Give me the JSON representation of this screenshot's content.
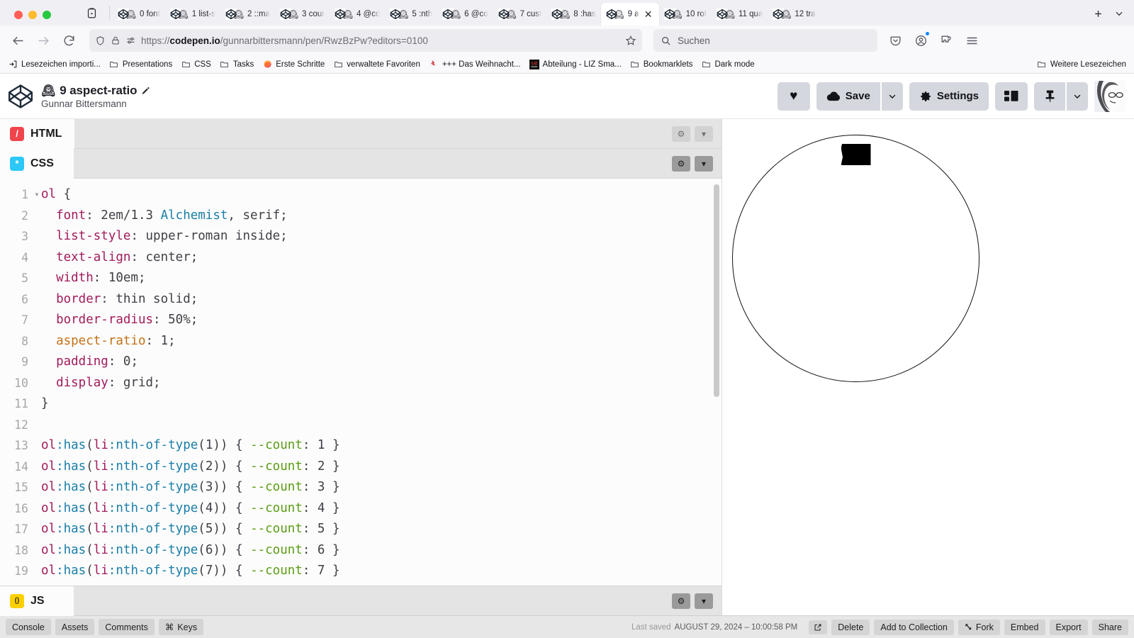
{
  "browser": {
    "window_controls": [
      "close",
      "minimize",
      "maximize"
    ],
    "tab_list_icon": "tab-list-icon",
    "tabs": [
      {
        "title": "0 font",
        "favicon": "codepen-icon",
        "overlay": "clock-emoji",
        "active": false
      },
      {
        "title": "1 list-s",
        "favicon": "codepen-icon",
        "overlay": "clock-emoji",
        "active": false
      },
      {
        "title": "2 ::ma",
        "favicon": "codepen-icon",
        "overlay": "clock-emoji",
        "active": false
      },
      {
        "title": "3 cour",
        "favicon": "codepen-icon",
        "overlay": "clock-emoji",
        "active": false
      },
      {
        "title": "4 @co",
        "favicon": "codepen-icon",
        "overlay": "clock-emoji",
        "active": false
      },
      {
        "title": "5 :nth",
        "favicon": "codepen-icon",
        "overlay": "clock-emoji",
        "active": false
      },
      {
        "title": "6 @co",
        "favicon": "codepen-icon",
        "overlay": "clock-emoji",
        "active": false
      },
      {
        "title": "7 cust",
        "favicon": "codepen-icon",
        "overlay": "clock-emoji",
        "active": false
      },
      {
        "title": "8 :has",
        "favicon": "codepen-icon",
        "overlay": "clock-emoji",
        "active": false
      },
      {
        "title": "9 a",
        "favicon": "codepen-icon",
        "overlay": "clock-emoji",
        "active": true
      },
      {
        "title": "10 rot",
        "favicon": "codepen-icon",
        "overlay": "clock-emoji",
        "active": false
      },
      {
        "title": "11 qua",
        "favicon": "codepen-icon",
        "overlay": "clock-emoji",
        "active": false
      },
      {
        "title": "12 tra",
        "favicon": "codepen-icon",
        "overlay": "clock-emoji",
        "active": false
      }
    ],
    "new_tab_label": "+",
    "list_all_tabs_label": "⌄",
    "nav": {
      "back": "back-arrow",
      "forward": "forward-arrow",
      "reload": "reload-icon",
      "url": "https://codepen.io/gunnarbittersmann/pen/RwzBzPw?editors=0100",
      "url_domain": "codepen.io",
      "url_prefix": "https://",
      "url_suffix": "/gunnarbittersmann/pen/RwzBzPw?editors=0100",
      "bookmark_star": "star-icon",
      "search_placeholder": "Suchen"
    },
    "bookmarks": [
      {
        "label": "Lesezeichen importi...",
        "icon": "import-icon"
      },
      {
        "label": "Presentations",
        "icon": "folder-icon"
      },
      {
        "label": "CSS",
        "icon": "folder-icon"
      },
      {
        "label": "Tasks",
        "icon": "folder-icon"
      },
      {
        "label": "Erste Schritte",
        "icon": "firefox-icon"
      },
      {
        "label": "verwaltete Favoriten",
        "icon": "folder-icon"
      },
      {
        "label": "+++ Das Weihnacht...",
        "icon": "bookmark-pin-icon"
      },
      {
        "label": "Abteilung - LIZ Sma...",
        "icon": "liz-icon"
      },
      {
        "label": "Bookmarklets",
        "icon": "folder-icon"
      },
      {
        "label": "Dark mode",
        "icon": "folder-icon"
      }
    ],
    "bookmarks_overflow": {
      "label": "Weitere Lesezeichen",
      "icon": "folder-icon"
    }
  },
  "pen": {
    "logo": "codepen-logo",
    "title_emoji": "🕰",
    "title": "9 aspect-ratio",
    "edit_icon": "pencil-icon",
    "author": "Gunnar Bittersmann",
    "actions": {
      "love_label": "♥",
      "save_label": "Save",
      "save_caret": "⌄",
      "settings_label": "Settings",
      "layout_label": "layout-icon",
      "pin_label": "pin-icon",
      "pin_caret": "⌄",
      "avatar": "user-avatar"
    }
  },
  "editors": [
    {
      "lang": "HTML",
      "badge": "/",
      "badge_color": "#f0444c",
      "open": false
    },
    {
      "lang": "CSS",
      "badge": "*",
      "badge_color": "#2cc8f7",
      "open": true
    },
    {
      "lang": "JS",
      "badge": "()",
      "badge_color": "#fcd000",
      "open": false
    }
  ],
  "pane_actions": {
    "settings_icon": "gear-icon",
    "collapse_icon": "chevron-down-icon"
  },
  "code": {
    "language": "CSS",
    "lines": [
      {
        "n": "1",
        "fold": "▾",
        "tokens": [
          {
            "t": "ol",
            "c": "t-tag"
          },
          {
            "t": " {",
            "c": "t-punc"
          }
        ]
      },
      {
        "n": "2",
        "fold": "",
        "tokens": [
          {
            "t": "  ",
            "c": "t-punc"
          },
          {
            "t": "font",
            "c": "t-prop"
          },
          {
            "t": ": 2em/1.3 ",
            "c": "t-val"
          },
          {
            "t": "Alchemist",
            "c": "t-font"
          },
          {
            "t": ", serif;",
            "c": "t-val"
          }
        ]
      },
      {
        "n": "3",
        "fold": "",
        "tokens": [
          {
            "t": "  ",
            "c": "t-punc"
          },
          {
            "t": "list-style",
            "c": "t-prop"
          },
          {
            "t": ": upper-roman inside;",
            "c": "t-val"
          }
        ]
      },
      {
        "n": "4",
        "fold": "",
        "tokens": [
          {
            "t": "  ",
            "c": "t-punc"
          },
          {
            "t": "text-align",
            "c": "t-prop"
          },
          {
            "t": ": center;",
            "c": "t-val"
          }
        ]
      },
      {
        "n": "5",
        "fold": "",
        "tokens": [
          {
            "t": "  ",
            "c": "t-punc"
          },
          {
            "t": "width",
            "c": "t-prop"
          },
          {
            "t": ": 10em;",
            "c": "t-val"
          }
        ]
      },
      {
        "n": "6",
        "fold": "",
        "tokens": [
          {
            "t": "  ",
            "c": "t-punc"
          },
          {
            "t": "border",
            "c": "t-prop"
          },
          {
            "t": ": thin solid;",
            "c": "t-val"
          }
        ]
      },
      {
        "n": "7",
        "fold": "",
        "tokens": [
          {
            "t": "  ",
            "c": "t-punc"
          },
          {
            "t": "border-radius",
            "c": "t-prop"
          },
          {
            "t": ": 50%;",
            "c": "t-val"
          }
        ]
      },
      {
        "n": "8",
        "fold": "",
        "tokens": [
          {
            "t": "  ",
            "c": "t-punc"
          },
          {
            "t": "aspect-ratio",
            "c": "t-prop2"
          },
          {
            "t": ": 1;",
            "c": "t-val"
          }
        ]
      },
      {
        "n": "9",
        "fold": "",
        "tokens": [
          {
            "t": "  ",
            "c": "t-punc"
          },
          {
            "t": "padding",
            "c": "t-prop"
          },
          {
            "t": ": 0;",
            "c": "t-val"
          }
        ]
      },
      {
        "n": "10",
        "fold": "",
        "tokens": [
          {
            "t": "  ",
            "c": "t-punc"
          },
          {
            "t": "display",
            "c": "t-prop"
          },
          {
            "t": ": grid;",
            "c": "t-val"
          }
        ]
      },
      {
        "n": "11",
        "fold": "",
        "tokens": [
          {
            "t": "}",
            "c": "t-punc"
          }
        ]
      },
      {
        "n": "12",
        "fold": "",
        "tokens": []
      },
      {
        "n": "13",
        "fold": "",
        "tokens": [
          {
            "t": "ol",
            "c": "t-tag"
          },
          {
            "t": ":has",
            "c": "t-pseudo"
          },
          {
            "t": "(",
            "c": "t-punc"
          },
          {
            "t": "li",
            "c": "t-tag"
          },
          {
            "t": ":nth-of-type",
            "c": "t-pseudo"
          },
          {
            "t": "(1)) { ",
            "c": "t-punc"
          },
          {
            "t": "--count",
            "c": "t-var"
          },
          {
            "t": ": 1 }",
            "c": "t-punc"
          }
        ]
      },
      {
        "n": "14",
        "fold": "",
        "tokens": [
          {
            "t": "ol",
            "c": "t-tag"
          },
          {
            "t": ":has",
            "c": "t-pseudo"
          },
          {
            "t": "(",
            "c": "t-punc"
          },
          {
            "t": "li",
            "c": "t-tag"
          },
          {
            "t": ":nth-of-type",
            "c": "t-pseudo"
          },
          {
            "t": "(2)) { ",
            "c": "t-punc"
          },
          {
            "t": "--count",
            "c": "t-var"
          },
          {
            "t": ": 2 }",
            "c": "t-punc"
          }
        ]
      },
      {
        "n": "15",
        "fold": "",
        "tokens": [
          {
            "t": "ol",
            "c": "t-tag"
          },
          {
            "t": ":has",
            "c": "t-pseudo"
          },
          {
            "t": "(",
            "c": "t-punc"
          },
          {
            "t": "li",
            "c": "t-tag"
          },
          {
            "t": ":nth-of-type",
            "c": "t-pseudo"
          },
          {
            "t": "(3)) { ",
            "c": "t-punc"
          },
          {
            "t": "--count",
            "c": "t-var"
          },
          {
            "t": ": 3 }",
            "c": "t-punc"
          }
        ]
      },
      {
        "n": "16",
        "fold": "",
        "tokens": [
          {
            "t": "ol",
            "c": "t-tag"
          },
          {
            "t": ":has",
            "c": "t-pseudo"
          },
          {
            "t": "(",
            "c": "t-punc"
          },
          {
            "t": "li",
            "c": "t-tag"
          },
          {
            "t": ":nth-of-type",
            "c": "t-pseudo"
          },
          {
            "t": "(4)) { ",
            "c": "t-punc"
          },
          {
            "t": "--count",
            "c": "t-var"
          },
          {
            "t": ": 4 }",
            "c": "t-punc"
          }
        ]
      },
      {
        "n": "17",
        "fold": "",
        "tokens": [
          {
            "t": "ol",
            "c": "t-tag"
          },
          {
            "t": ":has",
            "c": "t-pseudo"
          },
          {
            "t": "(",
            "c": "t-punc"
          },
          {
            "t": "li",
            "c": "t-tag"
          },
          {
            "t": ":nth-of-type",
            "c": "t-pseudo"
          },
          {
            "t": "(5)) { ",
            "c": "t-punc"
          },
          {
            "t": "--count",
            "c": "t-var"
          },
          {
            "t": ": 5 }",
            "c": "t-punc"
          }
        ]
      },
      {
        "n": "18",
        "fold": "",
        "tokens": [
          {
            "t": "ol",
            "c": "t-tag"
          },
          {
            "t": ":has",
            "c": "t-pseudo"
          },
          {
            "t": "(",
            "c": "t-punc"
          },
          {
            "t": "li",
            "c": "t-tag"
          },
          {
            "t": ":nth-of-type",
            "c": "t-pseudo"
          },
          {
            "t": "(6)) { ",
            "c": "t-punc"
          },
          {
            "t": "--count",
            "c": "t-var"
          },
          {
            "t": ": 6 }",
            "c": "t-punc"
          }
        ]
      },
      {
        "n": "19",
        "fold": "",
        "tokens": [
          {
            "t": "ol",
            "c": "t-tag"
          },
          {
            "t": ":has",
            "c": "t-pseudo"
          },
          {
            "t": "(",
            "c": "t-punc"
          },
          {
            "t": "li",
            "c": "t-tag"
          },
          {
            "t": ":nth-of-type",
            "c": "t-pseudo"
          },
          {
            "t": "(7)) { ",
            "c": "t-punc"
          },
          {
            "t": "--count",
            "c": "t-var"
          },
          {
            "t": ": 7 }",
            "c": "t-punc"
          }
        ]
      }
    ]
  },
  "preview": {
    "description": "circular ordered list rendered as a thin black circle with a single black roman numeral glyph at the top",
    "glyph": "I"
  },
  "bottombar": {
    "left_buttons": [
      {
        "label": "Console",
        "icon": ""
      },
      {
        "label": "Assets",
        "icon": ""
      },
      {
        "label": "Comments",
        "icon": ""
      },
      {
        "label": "Keys",
        "icon": "⌘"
      }
    ],
    "saved_label": "Last saved",
    "saved_value": "AUGUST 29, 2024 – 10:00:58 PM",
    "right_buttons": [
      {
        "label": "",
        "icon": "external-link-icon"
      },
      {
        "label": "Delete",
        "icon": ""
      },
      {
        "label": "Add to Collection",
        "icon": ""
      },
      {
        "label": "Fork",
        "icon": "fork-icon"
      },
      {
        "label": "Embed",
        "icon": ""
      },
      {
        "label": "Export",
        "icon": ""
      },
      {
        "label": "Share",
        "icon": ""
      }
    ]
  },
  "colors": {
    "accent_red": "#f0444c",
    "accent_blue": "#2cc8f7",
    "accent_yellow": "#fcd000",
    "chrome_bg": "#f9f9fb",
    "editor_bg": "#fcfcfc"
  }
}
